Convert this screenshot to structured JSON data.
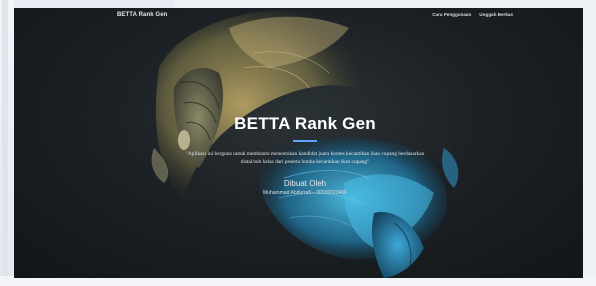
{
  "navbar": {
    "brand": "BETTA Rank Gen",
    "links": [
      "Cara Penggunaan",
      "Unggah Berkas"
    ]
  },
  "hero": {
    "title": "BETTA Rank Gen",
    "description": "\"Aplikasi ini berguna untuk membantu menentukan kandidat juara kontes kecantikan ikan cupang berdasarkan distal/sub kelas dari peserta lomba kecantikan ikan cupang\"",
    "author_heading": "Dibuat Oleh",
    "author_detail": "Muhammad Abdurrafi – 00000023456"
  },
  "colors": {
    "accent": "#5aa6ff",
    "hero_background": "#1c2125",
    "page_background": "#eef1f6"
  }
}
